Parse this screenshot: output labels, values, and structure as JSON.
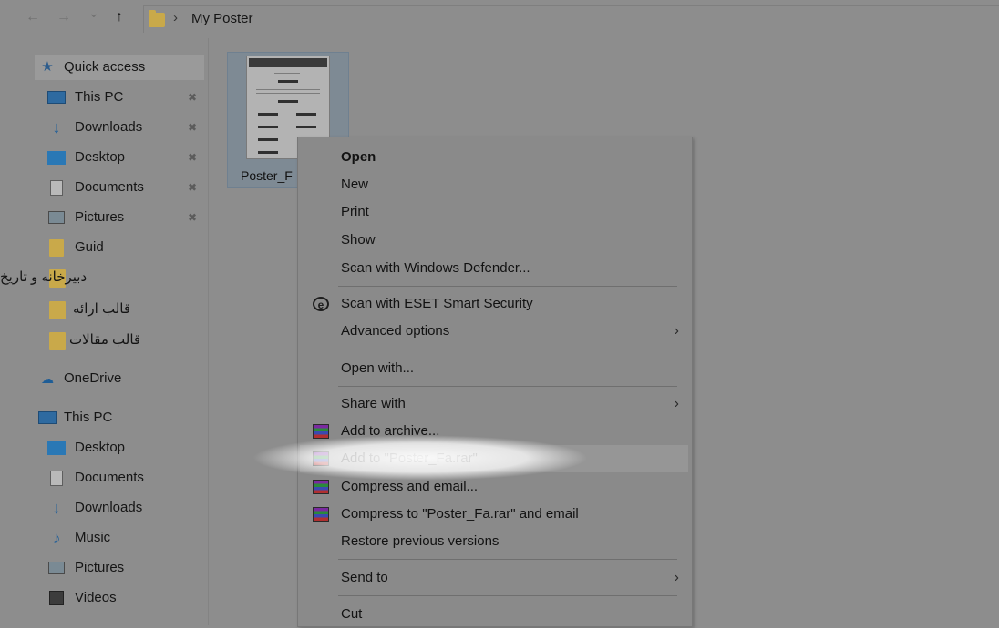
{
  "address": {
    "back": "←",
    "forward": "→",
    "dropdown": "⌄",
    "up": "↑",
    "separator": "›",
    "path": "My Poster"
  },
  "sidebar": {
    "quick_access": "Quick access",
    "items": [
      {
        "label": "This PC",
        "icon": "pc-icon",
        "pin": "✖"
      },
      {
        "label": "Downloads",
        "icon": "download-icon",
        "pin": "✖"
      },
      {
        "label": "Desktop",
        "icon": "desktop-icon",
        "pin": "✖"
      },
      {
        "label": "Documents",
        "icon": "documents-icon",
        "pin": "✖"
      },
      {
        "label": "Pictures",
        "icon": "pictures-icon",
        "pin": "✖"
      },
      {
        "label": "Guid",
        "icon": "folder-icon"
      }
    ],
    "rtl_items": [
      "دبیرخانه و تاریخ",
      "قالب ارائه",
      "قالب مقالات"
    ],
    "onedrive": "OneDrive",
    "this_pc": "This PC",
    "pc_items": [
      {
        "label": "Desktop",
        "icon": "desktop-icon"
      },
      {
        "label": "Documents",
        "icon": "documents-icon"
      },
      {
        "label": "Downloads",
        "icon": "download-icon"
      },
      {
        "label": "Music",
        "icon": "music-icon"
      },
      {
        "label": "Pictures",
        "icon": "pictures-icon"
      },
      {
        "label": "Videos",
        "icon": "videos-icon"
      }
    ]
  },
  "file": {
    "label": "Poster_F"
  },
  "context_menu": {
    "items": [
      {
        "label": "Open"
      },
      {
        "label": "New"
      },
      {
        "label": "Print"
      },
      {
        "label": "Show"
      },
      {
        "label": "Scan with Windows Defender..."
      },
      {
        "label": "Scan with ESET Smart Security"
      },
      {
        "label": "Advanced options",
        "arrow": "›"
      },
      {
        "label": "Open with..."
      },
      {
        "label": "Share with",
        "arrow": "›"
      },
      {
        "label": "Add to archive..."
      },
      {
        "label": "Add to \"Poster_Fa.rar\""
      },
      {
        "label": "Compress and email..."
      },
      {
        "label": "Compress to \"Poster_Fa.rar\" and email"
      },
      {
        "label": "Restore previous versions"
      },
      {
        "label": "Send to",
        "arrow": "›"
      },
      {
        "label": "Cut"
      }
    ]
  }
}
